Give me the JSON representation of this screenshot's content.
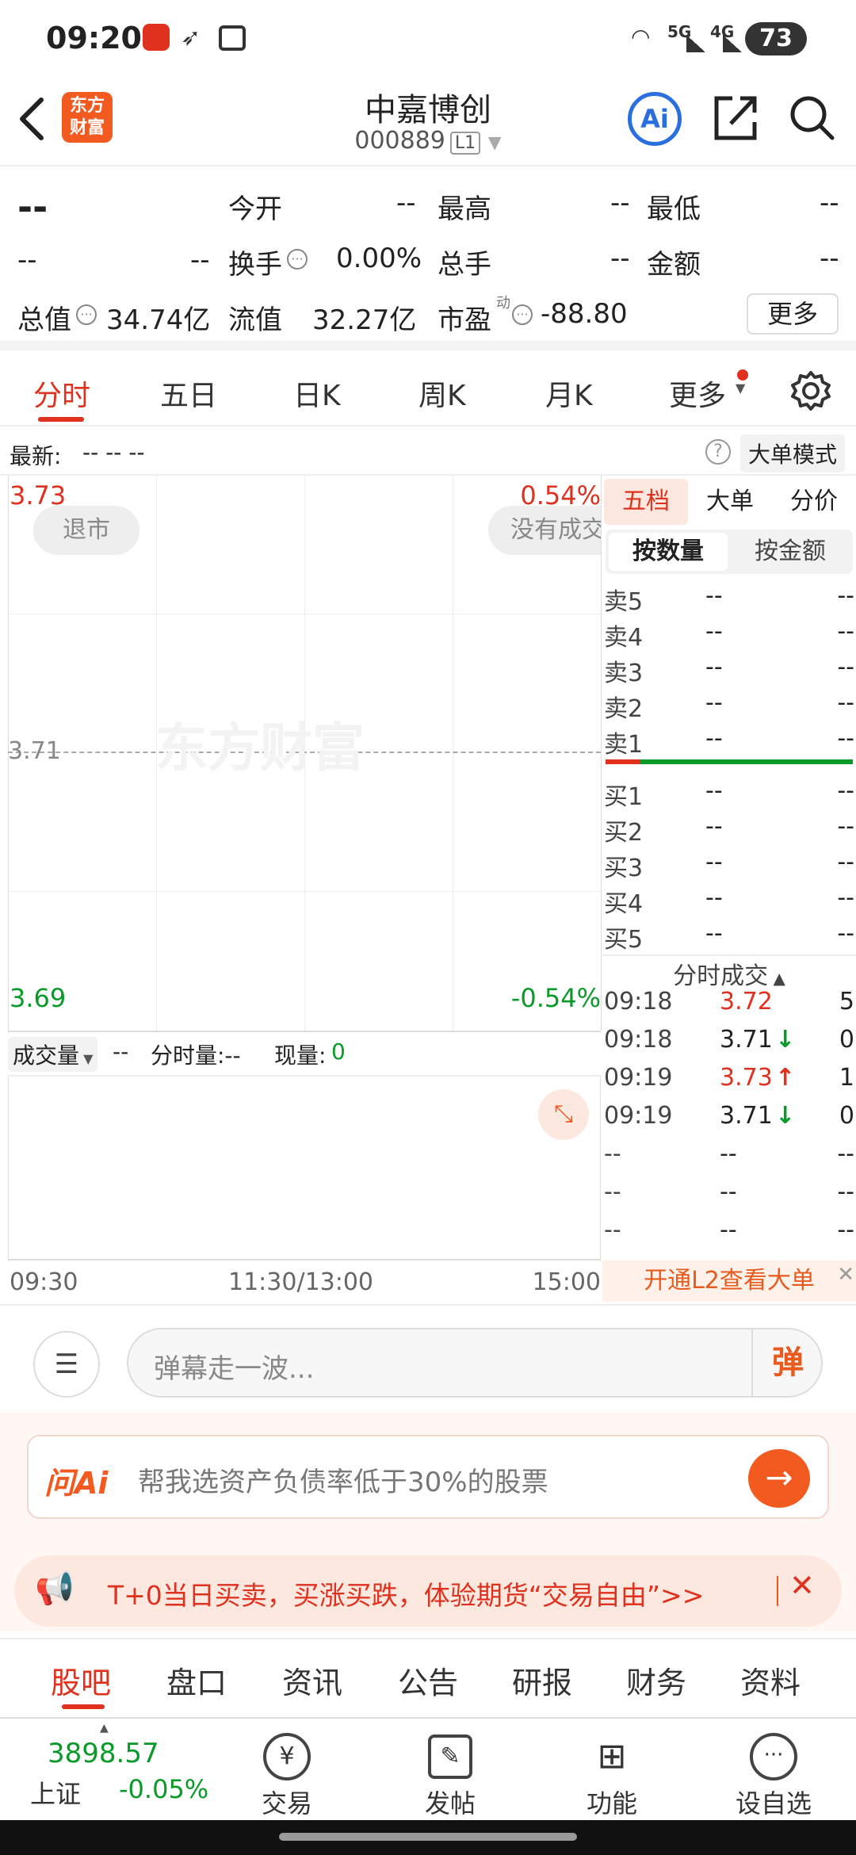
{
  "status_bar": {
    "time": "09:20",
    "battery": "73",
    "net1": "5G",
    "net2": "4G"
  },
  "header": {
    "logo": "东方财富",
    "name": "中嘉博创",
    "code": "000889",
    "level": "L1",
    "ai_label": "Ai"
  },
  "quote": {
    "price": "--",
    "change1": "--",
    "change2": "--",
    "items": [
      {
        "label": "今开",
        "value": "--"
      },
      {
        "label": "最高",
        "value": "--"
      },
      {
        "label": "最低",
        "value": "--"
      },
      {
        "label": "换手",
        "value": "0.00%"
      },
      {
        "label": "总手",
        "value": "--"
      },
      {
        "label": "金额",
        "value": "--"
      },
      {
        "label": "总值",
        "value": "34.74亿"
      },
      {
        "label": "流值",
        "value": "32.27亿"
      },
      {
        "label": "市盈",
        "value": "-88.80"
      }
    ],
    "pe_sup": "动",
    "more_button": "更多"
  },
  "chart_tabs": [
    "分时",
    "五日",
    "日K",
    "周K",
    "月K",
    "更多"
  ],
  "latest": {
    "label": "最新:",
    "value": "-- -- --",
    "big_order_mode": "大单模式"
  },
  "chart": {
    "top_price": "3.73",
    "top_pct": "0.54%",
    "mid_price": "3.71",
    "bottom_price": "3.69",
    "bottom_pct": "-0.54%",
    "badge_left": "退市",
    "badge_right": "没有成交",
    "watermark": "东方财富",
    "volume_label": "成交量",
    "volume_dash": "--",
    "split_volume": "分时量:--",
    "current_volume_label": "现量:",
    "current_volume_value": "0",
    "time_start": "09:30",
    "time_mid": "11:30/13:00",
    "time_end": "15:00"
  },
  "side": {
    "tabs": [
      "五档",
      "大单",
      "分价"
    ],
    "subtabs": [
      "按数量",
      "按金额"
    ],
    "sells": [
      {
        "label": "卖5",
        "price": "--",
        "vol": "--"
      },
      {
        "label": "卖4",
        "price": "--",
        "vol": "--"
      },
      {
        "label": "卖3",
        "price": "--",
        "vol": "--"
      },
      {
        "label": "卖2",
        "price": "--",
        "vol": "--"
      },
      {
        "label": "卖1",
        "price": "--",
        "vol": "--"
      }
    ],
    "buys": [
      {
        "label": "买1",
        "price": "--",
        "vol": "--"
      },
      {
        "label": "买2",
        "price": "--",
        "vol": "--"
      },
      {
        "label": "买3",
        "price": "--",
        "vol": "--"
      },
      {
        "label": "买4",
        "price": "--",
        "vol": "--"
      },
      {
        "label": "买5",
        "price": "--",
        "vol": "--"
      }
    ],
    "trades_title": "分时成交",
    "trades": [
      {
        "time": "09:18",
        "price": "3.72",
        "arrow": "",
        "vol": "5",
        "color": "red"
      },
      {
        "time": "09:18",
        "price": "3.71",
        "arrow": "↓",
        "vol": "0",
        "color": "black"
      },
      {
        "time": "09:19",
        "price": "3.73",
        "arrow": "↑",
        "vol": "1",
        "color": "red"
      },
      {
        "time": "09:19",
        "price": "3.71",
        "arrow": "↓",
        "vol": "0",
        "color": "black"
      },
      {
        "time": "--",
        "price": "--",
        "arrow": "",
        "vol": "--",
        "color": "black"
      },
      {
        "time": "--",
        "price": "--",
        "arrow": "",
        "vol": "--",
        "color": "black"
      },
      {
        "time": "--",
        "price": "--",
        "arrow": "",
        "vol": "--",
        "color": "black"
      }
    ],
    "l2_banner": "开通L2查看大单"
  },
  "danmu": {
    "placeholder": "弹幕走一波...",
    "send_label": "弹"
  },
  "ask_ai": {
    "brand": "问Ai",
    "prompt": "帮我选资产负债率低于30%的股票"
  },
  "promo": {
    "text": "T+0当日买卖，买涨买跌，体验期货“交易自由”>>"
  },
  "bottom_tabs": [
    "股吧",
    "盘口",
    "资讯",
    "公告",
    "研报",
    "财务",
    "资料"
  ],
  "navbar": {
    "index_value": "3898.57",
    "index_name": "上证",
    "index_change": "-0.05%",
    "items": [
      "交易",
      "发帖",
      "功能",
      "设自选"
    ]
  },
  "colors": {
    "up": "#e0301e",
    "down": "#0a9a2a",
    "brand": "#f25a1f",
    "ai_blue": "#2a6fe0"
  }
}
